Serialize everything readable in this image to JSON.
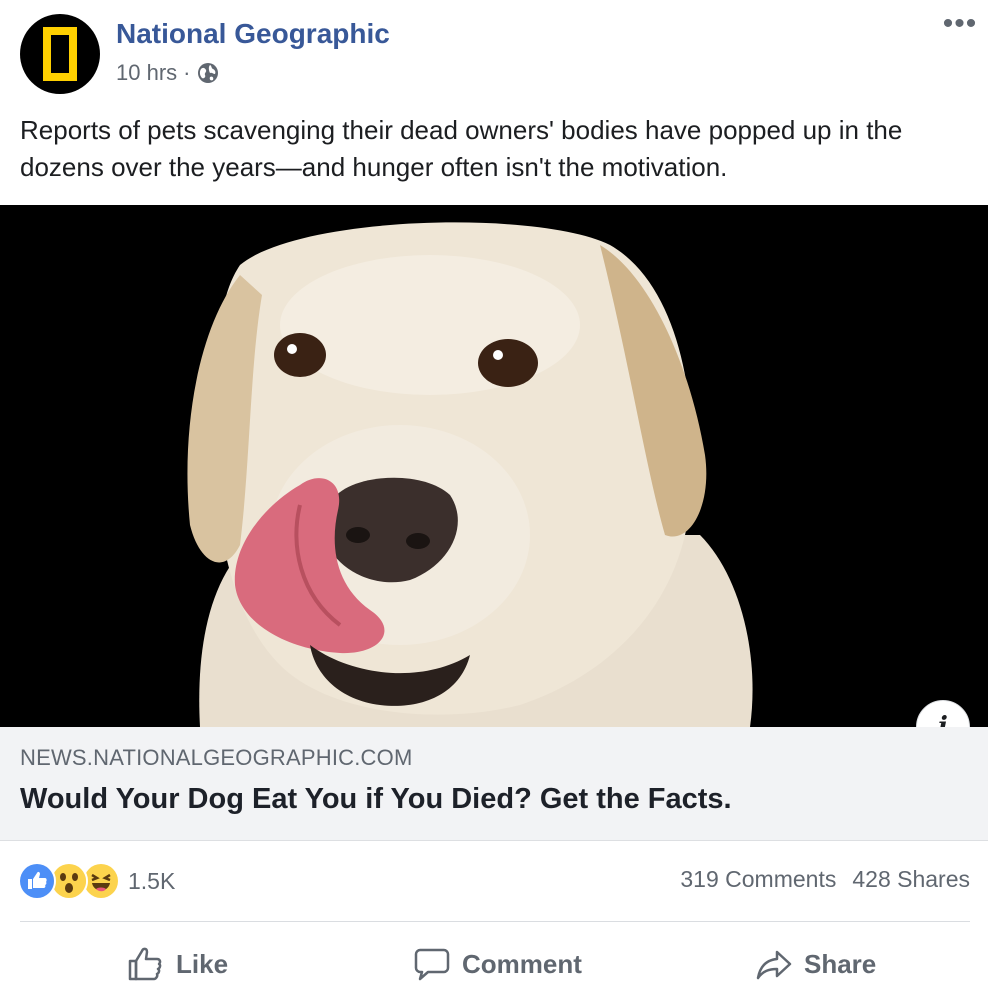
{
  "post": {
    "page_name": "National Geographic",
    "time": "10 hrs",
    "separator": "·",
    "audience_icon": "globe-icon",
    "text": "Reports of pets scavenging their dead owners' bodies have popped up in the dozens over the years—and hunger often isn't the motivation.",
    "more_label": "•••"
  },
  "link": {
    "domain": "NEWS.NATIONALGEOGRAPHIC.COM",
    "title": "Would Your Dog Eat You if You Died? Get the Facts.",
    "info_label": "i"
  },
  "stats": {
    "reactions": [
      "like-icon",
      "wow-icon",
      "haha-icon"
    ],
    "reaction_count": "1.5K",
    "comments": "319 Comments",
    "shares": "428 Shares"
  },
  "actions": {
    "like": "Like",
    "comment": "Comment",
    "share": "Share"
  },
  "colors": {
    "brand_blue": "#385898",
    "natgeo_yellow": "#ffd000",
    "meta_gray": "#606770",
    "link_box_bg": "#f2f3f5"
  }
}
